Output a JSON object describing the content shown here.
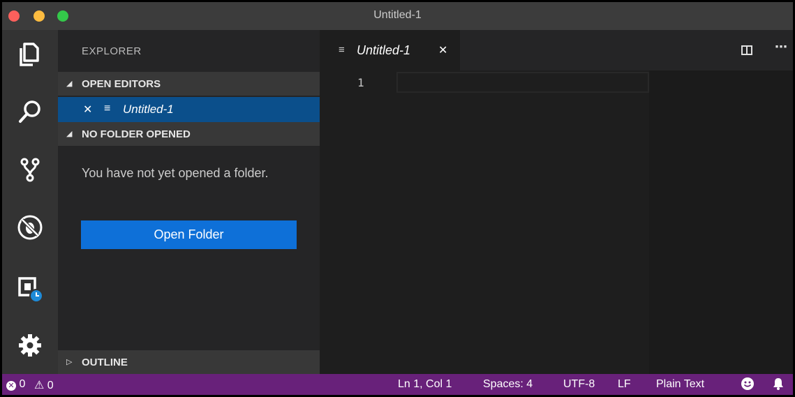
{
  "window": {
    "title": "Untitled-1"
  },
  "sidebar": {
    "title": "EXPLORER",
    "open_editors": {
      "header": "OPEN EDITORS",
      "items": [
        {
          "name": "Untitled-1"
        }
      ]
    },
    "no_folder": {
      "header": "NO FOLDER OPENED",
      "message": "You have not yet opened a folder.",
      "button": "Open Folder"
    },
    "outline": {
      "header": "OUTLINE"
    }
  },
  "editor": {
    "tab": {
      "name": "Untitled-1"
    },
    "line_number": "1"
  },
  "statusbar": {
    "errors": "0",
    "warnings": "0",
    "position": "Ln 1, Col 1",
    "spaces": "Spaces: 4",
    "encoding": "UTF-8",
    "eol": "LF",
    "language": "Plain Text"
  },
  "icons": {
    "activity": [
      "files-icon",
      "search-icon",
      "source-control-icon",
      "debug-icon",
      "remote-explorer-icon",
      "gear-icon"
    ],
    "status": [
      "error-icon",
      "warning-icon",
      "smiley-icon",
      "bell-icon"
    ]
  },
  "colors": {
    "statusbar_bg": "#68217a",
    "selected_item_bg": "#0b4f8b",
    "button_bg": "#0e70d8",
    "activitybar_bg": "#333333",
    "sidebar_bg": "#252526",
    "editor_bg": "#1e1e1e"
  }
}
